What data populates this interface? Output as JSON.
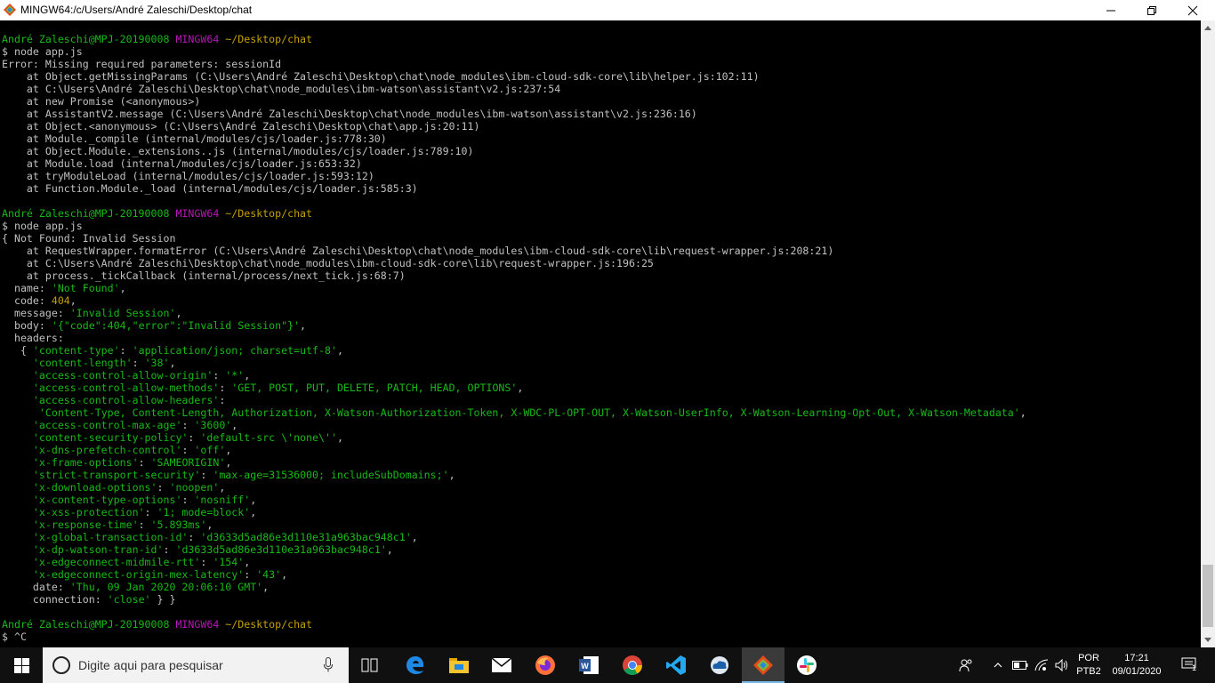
{
  "window": {
    "title": "MINGW64:/c/Users/André Zaleschi/Desktop/chat"
  },
  "terminal": {
    "lines": [
      [
        {
          "c": "green",
          "t": "André Zaleschi@MPJ-20190008 "
        },
        {
          "c": "mag",
          "t": "MINGW64 "
        },
        {
          "c": "yel",
          "t": "~/Desktop/chat"
        }
      ],
      [
        {
          "t": "$ node app.js"
        }
      ],
      [
        {
          "t": "Error: Missing required parameters: sessionId"
        }
      ],
      [
        {
          "t": "    at Object.getMissingParams (C:\\Users\\André Zaleschi\\Desktop\\chat\\node_modules\\ibm-cloud-sdk-core\\lib\\helper.js:102:11)"
        }
      ],
      [
        {
          "t": "    at C:\\Users\\André Zaleschi\\Desktop\\chat\\node_modules\\ibm-watson\\assistant\\v2.js:237:54"
        }
      ],
      [
        {
          "t": "    at new Promise (<anonymous>)"
        }
      ],
      [
        {
          "t": "    at AssistantV2.message (C:\\Users\\André Zaleschi\\Desktop\\chat\\node_modules\\ibm-watson\\assistant\\v2.js:236:16)"
        }
      ],
      [
        {
          "t": "    at Object.<anonymous> (C:\\Users\\André Zaleschi\\Desktop\\chat\\app.js:20:11)"
        }
      ],
      [
        {
          "t": "    at Module._compile (internal/modules/cjs/loader.js:778:30)"
        }
      ],
      [
        {
          "t": "    at Object.Module._extensions..js (internal/modules/cjs/loader.js:789:10)"
        }
      ],
      [
        {
          "t": "    at Module.load (internal/modules/cjs/loader.js:653:32)"
        }
      ],
      [
        {
          "t": "    at tryModuleLoad (internal/modules/cjs/loader.js:593:12)"
        }
      ],
      [
        {
          "t": "    at Function.Module._load (internal/modules/cjs/loader.js:585:3)"
        }
      ],
      [
        {
          "t": ""
        }
      ],
      [
        {
          "c": "green",
          "t": "André Zaleschi@MPJ-20190008 "
        },
        {
          "c": "mag",
          "t": "MINGW64 "
        },
        {
          "c": "yel",
          "t": "~/Desktop/chat"
        }
      ],
      [
        {
          "t": "$ node app.js"
        }
      ],
      [
        {
          "t": "{ Not Found: Invalid Session"
        }
      ],
      [
        {
          "t": "    at RequestWrapper.formatError (C:\\Users\\André Zaleschi\\Desktop\\chat\\node_modules\\ibm-cloud-sdk-core\\lib\\request-wrapper.js:208:21)"
        }
      ],
      [
        {
          "t": "    at C:\\Users\\André Zaleschi\\Desktop\\chat\\node_modules\\ibm-cloud-sdk-core\\lib\\request-wrapper.js:196:25"
        }
      ],
      [
        {
          "t": "    at process._tickCallback (internal/process/next_tick.js:68:7)"
        }
      ],
      [
        {
          "t": "  name: "
        },
        {
          "c": "str",
          "t": "'Not Found'"
        },
        {
          "t": ","
        }
      ],
      [
        {
          "t": "  code: "
        },
        {
          "c": "num",
          "t": "404"
        },
        {
          "t": ","
        }
      ],
      [
        {
          "t": "  message: "
        },
        {
          "c": "str",
          "t": "'Invalid Session'"
        },
        {
          "t": ","
        }
      ],
      [
        {
          "t": "  body: "
        },
        {
          "c": "str",
          "t": "'{\"code\":404,\"error\":\"Invalid Session\"}'"
        },
        {
          "t": ","
        }
      ],
      [
        {
          "t": "  headers:"
        }
      ],
      [
        {
          "t": "   { "
        },
        {
          "c": "str",
          "t": "'content-type'"
        },
        {
          "t": ": "
        },
        {
          "c": "str",
          "t": "'application/json; charset=utf-8'"
        },
        {
          "t": ","
        }
      ],
      [
        {
          "t": "     "
        },
        {
          "c": "str",
          "t": "'content-length'"
        },
        {
          "t": ": "
        },
        {
          "c": "str",
          "t": "'38'"
        },
        {
          "t": ","
        }
      ],
      [
        {
          "t": "     "
        },
        {
          "c": "str",
          "t": "'access-control-allow-origin'"
        },
        {
          "t": ": "
        },
        {
          "c": "str",
          "t": "'*'"
        },
        {
          "t": ","
        }
      ],
      [
        {
          "t": "     "
        },
        {
          "c": "str",
          "t": "'access-control-allow-methods'"
        },
        {
          "t": ": "
        },
        {
          "c": "str",
          "t": "'GET, POST, PUT, DELETE, PATCH, HEAD, OPTIONS'"
        },
        {
          "t": ","
        }
      ],
      [
        {
          "t": "     "
        },
        {
          "c": "str",
          "t": "'access-control-allow-headers'"
        },
        {
          "t": ":"
        }
      ],
      [
        {
          "t": "      "
        },
        {
          "c": "str",
          "t": "'Content-Type, Content-Length, Authorization, X-Watson-Authorization-Token, X-WDC-PL-OPT-OUT, X-Watson-UserInfo, X-Watson-Learning-Opt-Out, X-Watson-Metadata'"
        },
        {
          "t": ","
        }
      ],
      [
        {
          "t": "     "
        },
        {
          "c": "str",
          "t": "'access-control-max-age'"
        },
        {
          "t": ": "
        },
        {
          "c": "str",
          "t": "'3600'"
        },
        {
          "t": ","
        }
      ],
      [
        {
          "t": "     "
        },
        {
          "c": "str",
          "t": "'content-security-policy'"
        },
        {
          "t": ": "
        },
        {
          "c": "str",
          "t": "'default-src \\'none\\''"
        },
        {
          "t": ","
        }
      ],
      [
        {
          "t": "     "
        },
        {
          "c": "str",
          "t": "'x-dns-prefetch-control'"
        },
        {
          "t": ": "
        },
        {
          "c": "str",
          "t": "'off'"
        },
        {
          "t": ","
        }
      ],
      [
        {
          "t": "     "
        },
        {
          "c": "str",
          "t": "'x-frame-options'"
        },
        {
          "t": ": "
        },
        {
          "c": "str",
          "t": "'SAMEORIGIN'"
        },
        {
          "t": ","
        }
      ],
      [
        {
          "t": "     "
        },
        {
          "c": "str",
          "t": "'strict-transport-security'"
        },
        {
          "t": ": "
        },
        {
          "c": "str",
          "t": "'max-age=31536000; includeSubDomains;'"
        },
        {
          "t": ","
        }
      ],
      [
        {
          "t": "     "
        },
        {
          "c": "str",
          "t": "'x-download-options'"
        },
        {
          "t": ": "
        },
        {
          "c": "str",
          "t": "'noopen'"
        },
        {
          "t": ","
        }
      ],
      [
        {
          "t": "     "
        },
        {
          "c": "str",
          "t": "'x-content-type-options'"
        },
        {
          "t": ": "
        },
        {
          "c": "str",
          "t": "'nosniff'"
        },
        {
          "t": ","
        }
      ],
      [
        {
          "t": "     "
        },
        {
          "c": "str",
          "t": "'x-xss-protection'"
        },
        {
          "t": ": "
        },
        {
          "c": "str",
          "t": "'1; mode=block'"
        },
        {
          "t": ","
        }
      ],
      [
        {
          "t": "     "
        },
        {
          "c": "str",
          "t": "'x-response-time'"
        },
        {
          "t": ": "
        },
        {
          "c": "str",
          "t": "'5.893ms'"
        },
        {
          "t": ","
        }
      ],
      [
        {
          "t": "     "
        },
        {
          "c": "str",
          "t": "'x-global-transaction-id'"
        },
        {
          "t": ": "
        },
        {
          "c": "str",
          "t": "'d3633d5ad86e3d110e31a963bac948c1'"
        },
        {
          "t": ","
        }
      ],
      [
        {
          "t": "     "
        },
        {
          "c": "str",
          "t": "'x-dp-watson-tran-id'"
        },
        {
          "t": ": "
        },
        {
          "c": "str",
          "t": "'d3633d5ad86e3d110e31a963bac948c1'"
        },
        {
          "t": ","
        }
      ],
      [
        {
          "t": "     "
        },
        {
          "c": "str",
          "t": "'x-edgeconnect-midmile-rtt'"
        },
        {
          "t": ": "
        },
        {
          "c": "str",
          "t": "'154'"
        },
        {
          "t": ","
        }
      ],
      [
        {
          "t": "     "
        },
        {
          "c": "str",
          "t": "'x-edgeconnect-origin-mex-latency'"
        },
        {
          "t": ": "
        },
        {
          "c": "str",
          "t": "'43'"
        },
        {
          "t": ","
        }
      ],
      [
        {
          "t": "     date: "
        },
        {
          "c": "str",
          "t": "'Thu, 09 Jan 2020 20:06:10 GMT'"
        },
        {
          "t": ","
        }
      ],
      [
        {
          "t": "     connection: "
        },
        {
          "c": "str",
          "t": "'close'"
        },
        {
          "t": " } }"
        }
      ],
      [
        {
          "t": ""
        }
      ],
      [
        {
          "c": "green",
          "t": "André Zaleschi@MPJ-20190008 "
        },
        {
          "c": "mag",
          "t": "MINGW64 "
        },
        {
          "c": "yel",
          "t": "~/Desktop/chat"
        }
      ],
      [
        {
          "t": "$ ^C"
        }
      ]
    ]
  },
  "taskbar": {
    "search_placeholder": "Digite aqui para pesquisar",
    "apps": [
      {
        "name": "task-view-icon"
      },
      {
        "name": "edge-icon"
      },
      {
        "name": "file-explorer-icon"
      },
      {
        "name": "mail-icon"
      },
      {
        "name": "firefox-icon"
      },
      {
        "name": "word-icon"
      },
      {
        "name": "chrome-icon"
      },
      {
        "name": "vscode-icon"
      },
      {
        "name": "ibm-cloud-icon"
      },
      {
        "name": "git-bash-icon"
      },
      {
        "name": "slack-icon"
      }
    ],
    "tray": {
      "language": "POR",
      "keyboard": "PTB2",
      "time": "17:21",
      "date": "09/01/2020",
      "notification_count": "1"
    }
  },
  "colors": {
    "green": "#18b818",
    "magenta": "#b418b4",
    "yellow": "#c4a000",
    "text": "#c0c0c0"
  }
}
